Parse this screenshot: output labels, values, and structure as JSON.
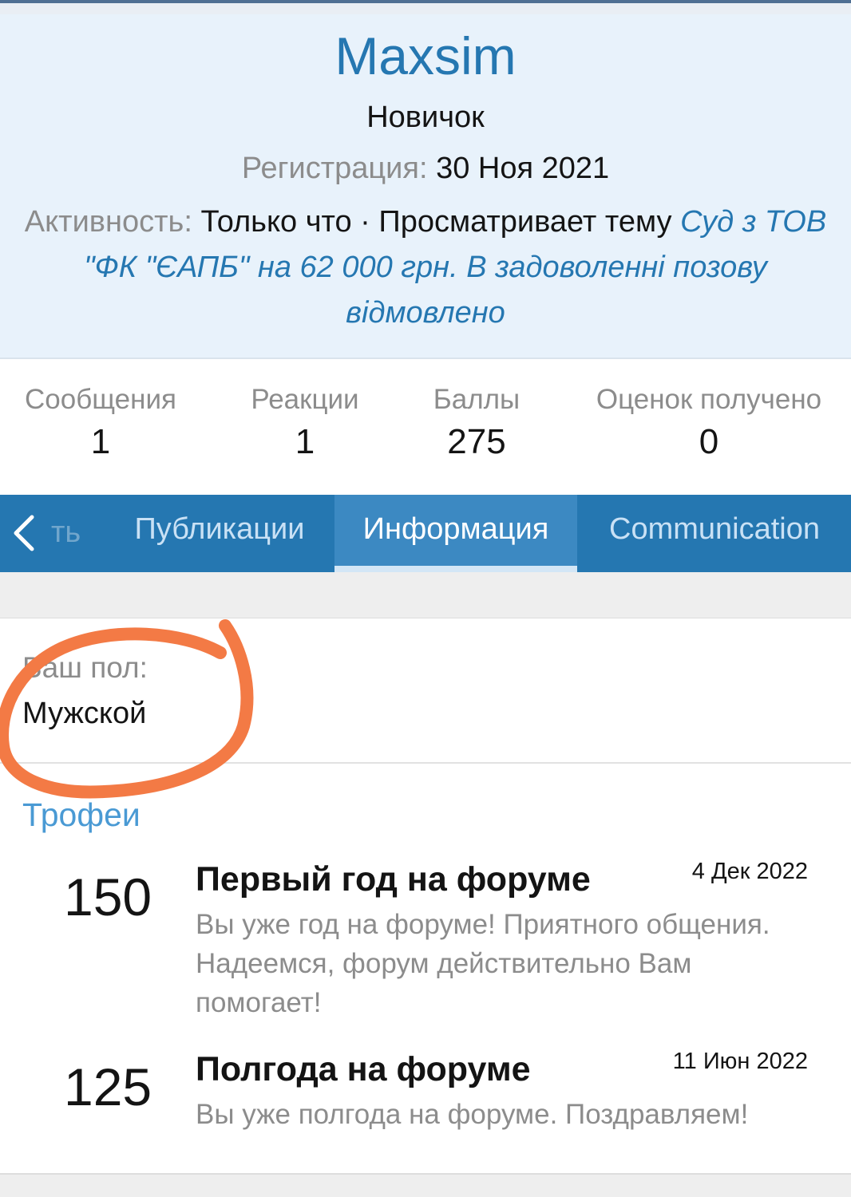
{
  "profile": {
    "username": "Maxsim",
    "user_title": "Новичок",
    "registration_label": "Регистрация:",
    "registration_date": "30 Ноя 2021",
    "activity_label": "Активность:",
    "activity_text": "Только что · Просматривает тему",
    "activity_thread": "Суд з ТОВ \"ФК \"ЄАПБ\" на 62 000 грн. В задоволенні позову відмовлено"
  },
  "stats": [
    {
      "label": "Сообщения",
      "value": "1"
    },
    {
      "label": "Реакции",
      "value": "1"
    },
    {
      "label": "Баллы",
      "value": "275"
    },
    {
      "label": "Оценок получено",
      "value": "0"
    }
  ],
  "tabs": {
    "hidden_partial": "ть",
    "items": [
      {
        "label": "Публикации",
        "active": false
      },
      {
        "label": "Информация",
        "active": true
      },
      {
        "label": "Communication",
        "active": false
      }
    ]
  },
  "about": {
    "field_label": "Ваш пол:",
    "field_value": "Мужской"
  },
  "trophies": {
    "heading": "Трофеи",
    "items": [
      {
        "points": "150",
        "title": "Первый год на форуме",
        "date": "4 Дек 2022",
        "description": "Вы уже год на форуме! Приятного общения. Надеемся, форум действительно Вам помогает!"
      },
      {
        "points": "125",
        "title": "Полгода на форуме",
        "date": "11 Июн 2022",
        "description": "Вы уже полгода на форуме. Поздравляем!"
      }
    ]
  },
  "colors": {
    "accent": "#2577b1",
    "header_bg": "#e8f2fb",
    "annotation": "#f37a45"
  }
}
